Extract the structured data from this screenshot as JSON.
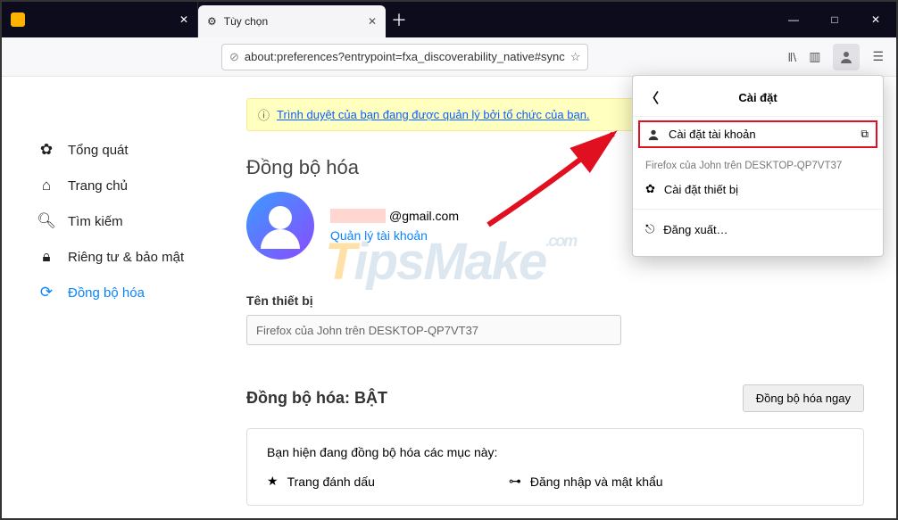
{
  "tabs": {
    "inactive_title": "",
    "active_title": "Tùy chọn"
  },
  "url": "about:preferences?entrypoint=fxa_discoverability_native#sync",
  "sidebar": {
    "items": [
      {
        "label": "Tổng quát"
      },
      {
        "label": "Trang chủ"
      },
      {
        "label": "Tìm kiếm"
      },
      {
        "label": "Riêng tư & bảo mật"
      },
      {
        "label": "Đồng bộ hóa"
      }
    ]
  },
  "notice": "Trình duyệt của bạn đang được quản lý bởi tổ chức của bạn.",
  "main": {
    "heading": "Đồng bộ hóa",
    "email_suffix": "@gmail.com",
    "manage": "Quản lý tài khoản",
    "device_label": "Tên thiết bị",
    "device_value": "Firefox của John trên DESKTOP-QP7VT37",
    "sync_heading": "Đồng bộ hóa: BẬT",
    "sync_now": "Đồng bộ hóa ngay",
    "panel_title": "Bạn hiện đang đồng bộ hóa các mục này:",
    "item_bookmarks": "Trang đánh dấu",
    "item_logins": "Đăng nhập và mật khẩu"
  },
  "popup": {
    "title": "Cài đặt",
    "account_settings": "Cài đặt tài khoản",
    "device_line": "Firefox của John trên DESKTOP-QP7VT37",
    "device_settings": "Cài đặt thiết bị",
    "sign_out": "Đăng xuất…"
  },
  "watermark": "TipsMake",
  "watermark_suffix": ".com"
}
